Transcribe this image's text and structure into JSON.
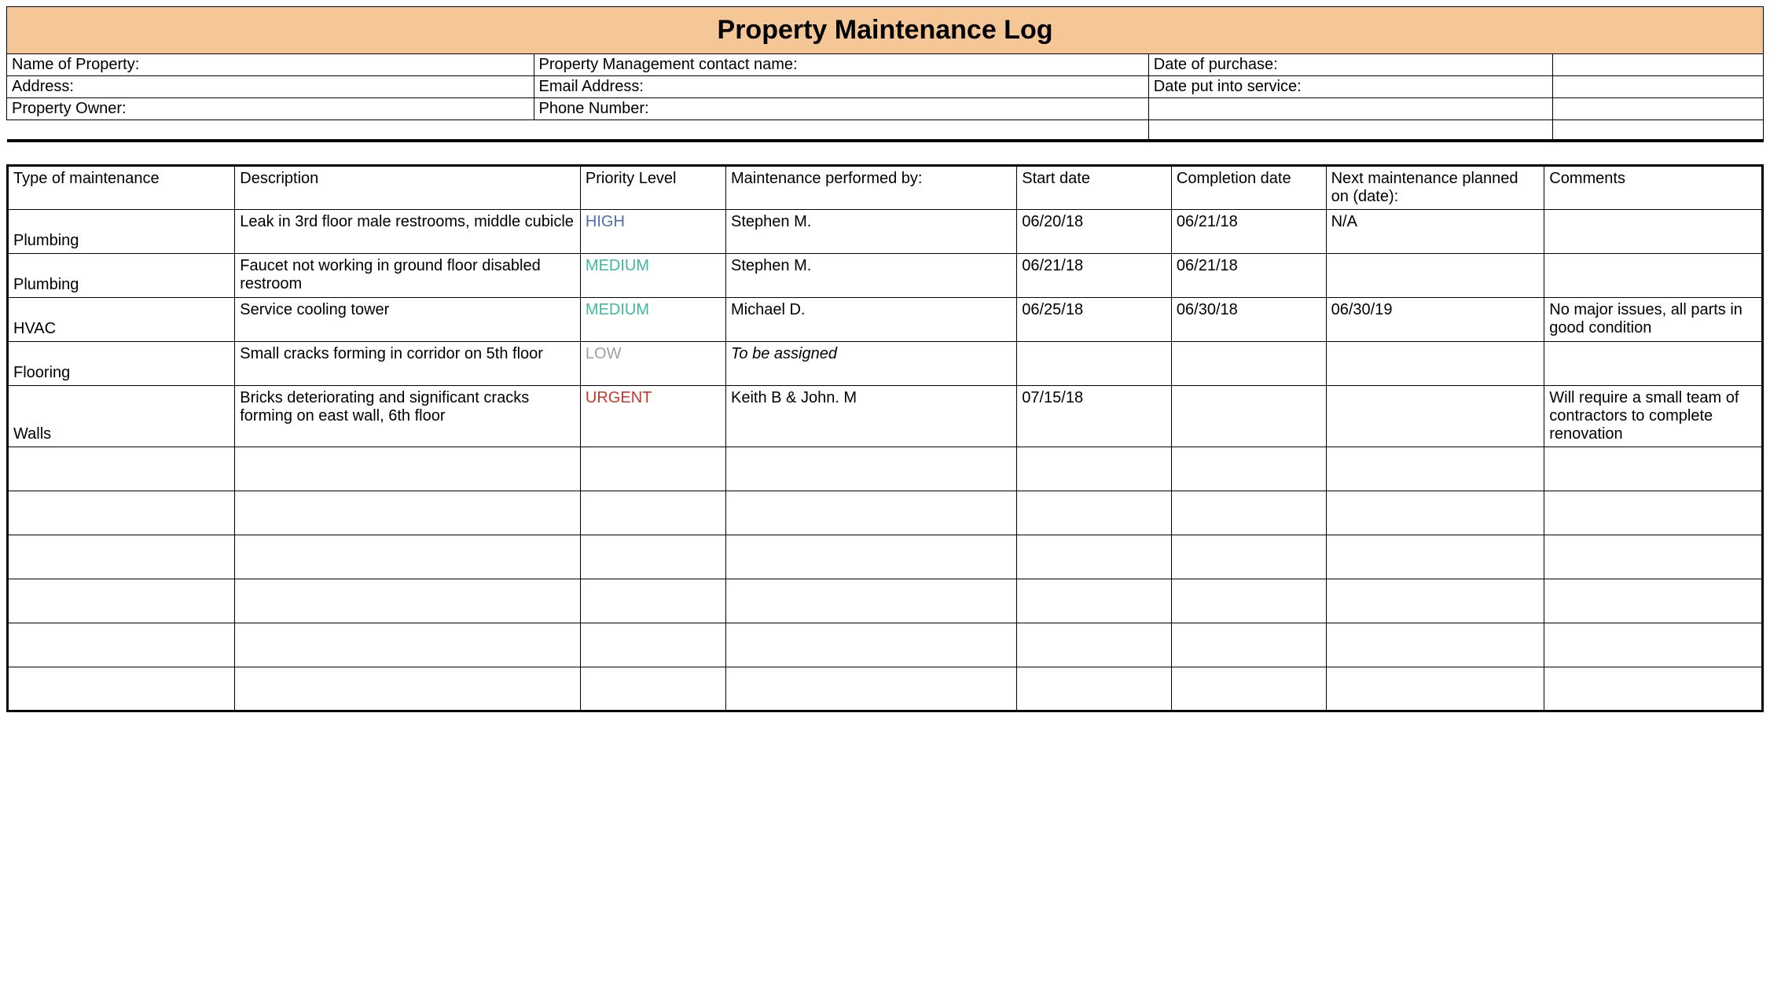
{
  "title": "Property Maintenance Log",
  "info": {
    "row1": {
      "c1": "Name of Property:",
      "c2": "Property Management contact name:",
      "c3": "Date of purchase:",
      "c4": ""
    },
    "row2": {
      "c1": "Address:",
      "c2": "Email Address:",
      "c3": "Date put into service:",
      "c4": ""
    },
    "row3": {
      "c1": "Property Owner:",
      "c2": "Phone Number:",
      "c3": "",
      "c4": ""
    },
    "row4": {
      "c1": "",
      "c2": "",
      "c3": "",
      "c4": ""
    }
  },
  "columns": {
    "type": "Type of maintenance",
    "desc": "Description",
    "priority": "Priority Level",
    "performed": "Maintenance performed by:",
    "start": "Start date",
    "completion": "Completion date",
    "next": "Next maintenance planned on (date):",
    "comments": "Comments"
  },
  "priority_colors": {
    "HIGH": "#4a6fb3",
    "MEDIUM": "#3fb8a0",
    "LOW": "#9e9e9e",
    "URGENT": "#c0392b"
  },
  "rows": [
    {
      "type": "Plumbing",
      "desc": "Leak in 3rd floor male restrooms, middle cubicle",
      "priority": "HIGH",
      "performed": "Stephen M.",
      "performed_italic": false,
      "start": "06/20/18",
      "completion": "06/21/18",
      "next": "N/A",
      "comments": ""
    },
    {
      "type": "Plumbing",
      "desc": "Faucet not working in ground floor disabled restroom",
      "priority": "MEDIUM",
      "performed": "Stephen M.",
      "performed_italic": false,
      "start": "06/21/18",
      "completion": "06/21/18",
      "next": "",
      "comments": ""
    },
    {
      "type": "HVAC",
      "desc": "Service cooling tower",
      "priority": "MEDIUM",
      "performed": "Michael D.",
      "performed_italic": false,
      "start": "06/25/18",
      "completion": "06/30/18",
      "next": "06/30/19",
      "comments": "No major issues, all parts in good condition"
    },
    {
      "type": "Flooring",
      "desc": "Small cracks forming in corridor on 5th floor",
      "priority": "LOW",
      "performed": "To be assigned",
      "performed_italic": true,
      "start": "",
      "completion": "",
      "next": "",
      "comments": ""
    },
    {
      "type": "Walls",
      "desc": "Bricks deteriorating and significant cracks forming on east wall, 6th floor",
      "priority": "URGENT",
      "performed": "Keith B & John. M",
      "performed_italic": false,
      "start": "07/15/18",
      "completion": "",
      "next": "",
      "comments": "Will require a small team of contractors to complete renovation"
    },
    {
      "type": "",
      "desc": "",
      "priority": "",
      "performed": "",
      "performed_italic": false,
      "start": "",
      "completion": "",
      "next": "",
      "comments": ""
    },
    {
      "type": "",
      "desc": "",
      "priority": "",
      "performed": "",
      "performed_italic": false,
      "start": "",
      "completion": "",
      "next": "",
      "comments": ""
    },
    {
      "type": "",
      "desc": "",
      "priority": "",
      "performed": "",
      "performed_italic": false,
      "start": "",
      "completion": "",
      "next": "",
      "comments": ""
    },
    {
      "type": "",
      "desc": "",
      "priority": "",
      "performed": "",
      "performed_italic": false,
      "start": "",
      "completion": "",
      "next": "",
      "comments": ""
    },
    {
      "type": "",
      "desc": "",
      "priority": "",
      "performed": "",
      "performed_italic": false,
      "start": "",
      "completion": "",
      "next": "",
      "comments": ""
    },
    {
      "type": "",
      "desc": "",
      "priority": "",
      "performed": "",
      "performed_italic": false,
      "start": "",
      "completion": "",
      "next": "",
      "comments": ""
    }
  ]
}
